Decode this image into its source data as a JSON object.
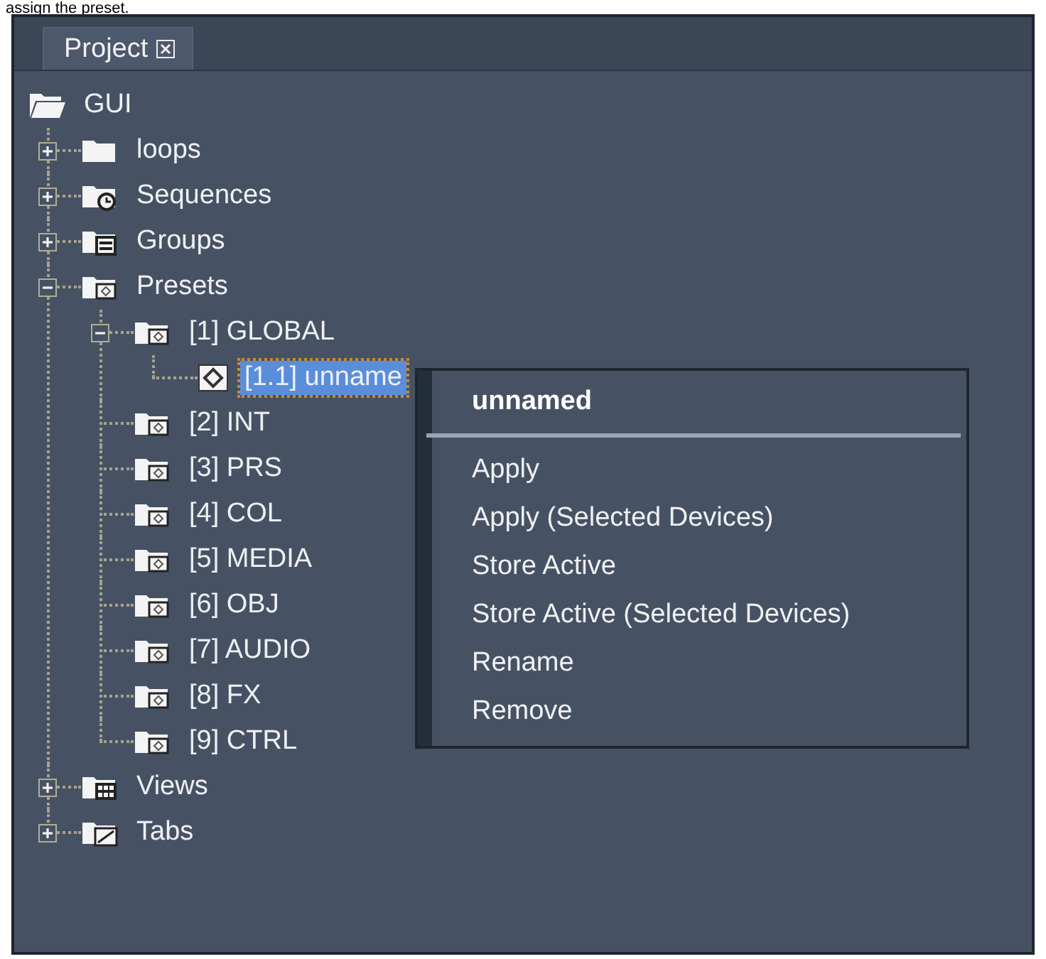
{
  "caption": "assign the preset.",
  "tabs": [
    {
      "label": "Project",
      "selected": true
    }
  ],
  "tree": [
    {
      "label": "GUI",
      "kind": "folder-open",
      "selected": false,
      "children": [
        {
          "label": "loops",
          "kind": "folder",
          "expanded": false,
          "selected": false
        },
        {
          "label": "Sequences",
          "kind": "sequences",
          "expanded": false,
          "selected": false
        },
        {
          "label": "Groups",
          "kind": "groups",
          "expanded": false,
          "selected": false
        },
        {
          "label": "Presets",
          "kind": "presets",
          "expanded": true,
          "selected": false,
          "children": [
            {
              "label": "[1] GLOBAL",
              "kind": "presets",
              "expanded": true,
              "selected": false,
              "children": [
                {
                  "label": "[1.1] unname",
                  "kind": "preset",
                  "selected": true
                }
              ]
            },
            {
              "label": "[2] INT",
              "kind": "presets",
              "selected": false
            },
            {
              "label": "[3] PRS",
              "kind": "presets",
              "selected": false
            },
            {
              "label": "[4] COL",
              "kind": "presets",
              "selected": false
            },
            {
              "label": "[5] MEDIA",
              "kind": "presets",
              "selected": false
            },
            {
              "label": "[6] OBJ",
              "kind": "presets",
              "selected": false
            },
            {
              "label": "[7] AUDIO",
              "kind": "presets",
              "selected": false
            },
            {
              "label": "[8] FX",
              "kind": "presets",
              "selected": false
            },
            {
              "label": "[9] CTRL",
              "kind": "presets",
              "selected": false
            }
          ]
        },
        {
          "label": "Views",
          "kind": "views",
          "expanded": false,
          "selected": false
        },
        {
          "label": "Tabs",
          "kind": "tabs",
          "expanded": false,
          "selected": false
        }
      ]
    }
  ],
  "context_menu": {
    "title": "unnamed",
    "items": [
      "Apply",
      "Apply (Selected Devices)",
      "Store Active",
      "Store Active (Selected Devices)",
      "Rename",
      "Remove"
    ]
  }
}
